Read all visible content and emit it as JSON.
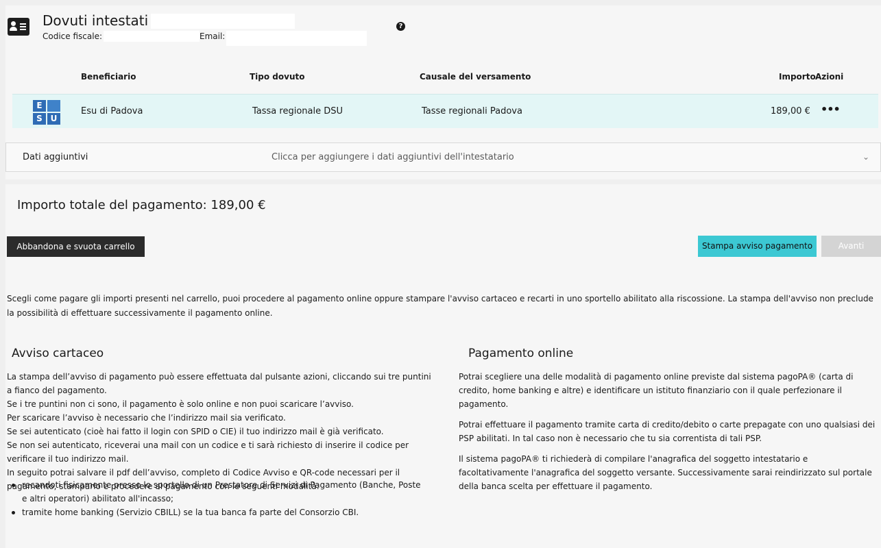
{
  "header": {
    "title": "Dovuti intestati a:",
    "codice_fiscale_label": "Codice fiscale: D",
    "email_label": "Email:",
    "help_glyph": "?"
  },
  "table": {
    "columns": [
      "Beneficiario",
      "Tipo dovuto",
      "Causale del versamento",
      "Importo",
      "Azioni"
    ],
    "rows": [
      {
        "logo_letters": [
          "E",
          "",
          "S",
          "U"
        ],
        "beneficiario": "Esu di Padova",
        "tipo_dovuto": "Tassa regionale DSU",
        "causale": "Tasse regionali Padova",
        "importo": "189,00 €",
        "azioni_glyph": "•••"
      }
    ]
  },
  "dati_aggiuntivi": {
    "label": "Dati aggiuntivi",
    "hint": "Clicca per aggiungere i dati aggiuntivi dell'intestatario",
    "chevron": "⌄"
  },
  "summary": {
    "total": "Importo totale del pagamento: 189,00 €"
  },
  "buttons": {
    "abbandona": "Abbandona e svuota carrello",
    "stampa": "Stampa avviso pagamento",
    "avanti": "Avanti"
  },
  "intro": "Scegli come pagare gli importi presenti nel carrello, puoi procedere al pagamento online oppure stampare l'avviso cartaceo e recarti in uno sportello abilitato alla riscossione. La stampa dell'avviso non preclude la possibilità di effettuare successivamente il pagamento online.",
  "avviso": {
    "heading": "Avviso cartaceo",
    "lines": [
      "La stampa dell’avviso di pagamento può essere effettuata dal pulsante azioni, cliccando sui tre puntini",
      "a fianco del pagamento.",
      "Se i tre puntini non ci sono, il pagamento è solo online e non puoi scaricare l’avviso.",
      "Per scaricare l’avviso è necessario che l’indirizzo mail sia verificato.",
      "Se sei autenticato (cioè hai fatto il login con SPID o CIE) il tuo indirizzo mail è già verificato.",
      "Se non sei autenticato, riceverai una mail con un codice e ti sarà richiesto di inserire il codice per",
      "verificare il tuo indirizzo mail.",
      "In seguito potrai salvare il pdf dell’avviso, completo di Codice Avviso e QR-code necessari per il",
      "pagamento, stamparlo e procedere al pagamento con le seguenti modalità:"
    ],
    "bullets": [
      "recandoti fisicamente presso lo sportello di un Prestatore di Servizi di Pagamento (Banche, Poste",
      "e altri operatori) abilitato all'incasso;",
      "tramite home banking (Servizio CBILL) se la tua banca fa parte del Consorzio CBI."
    ]
  },
  "online": {
    "heading": "Pagamento online",
    "paragraphs": [
      "Potrai scegliere una delle modalità di pagamento online previste dal sistema pagoPA® (carta di credito, home banking e altre) e identificare un istituto finanziario con il quale perfezionare il pagamento.",
      "Potrai effettuare il pagamento tramite carta di credito/debito o carte prepagate con uno qualsiasi dei PSP abilitati. In tal caso non è necessario che tu sia correntista di tali PSP.",
      "Il sistema pagoPA® ti richiederà di compilare l'anagrafica del soggetto intestatario e facoltativamente l'anagrafica del soggetto versante. Successivamente sarai reindirizzato sul portale della banca scelta per effettuare il pagamento."
    ]
  }
}
